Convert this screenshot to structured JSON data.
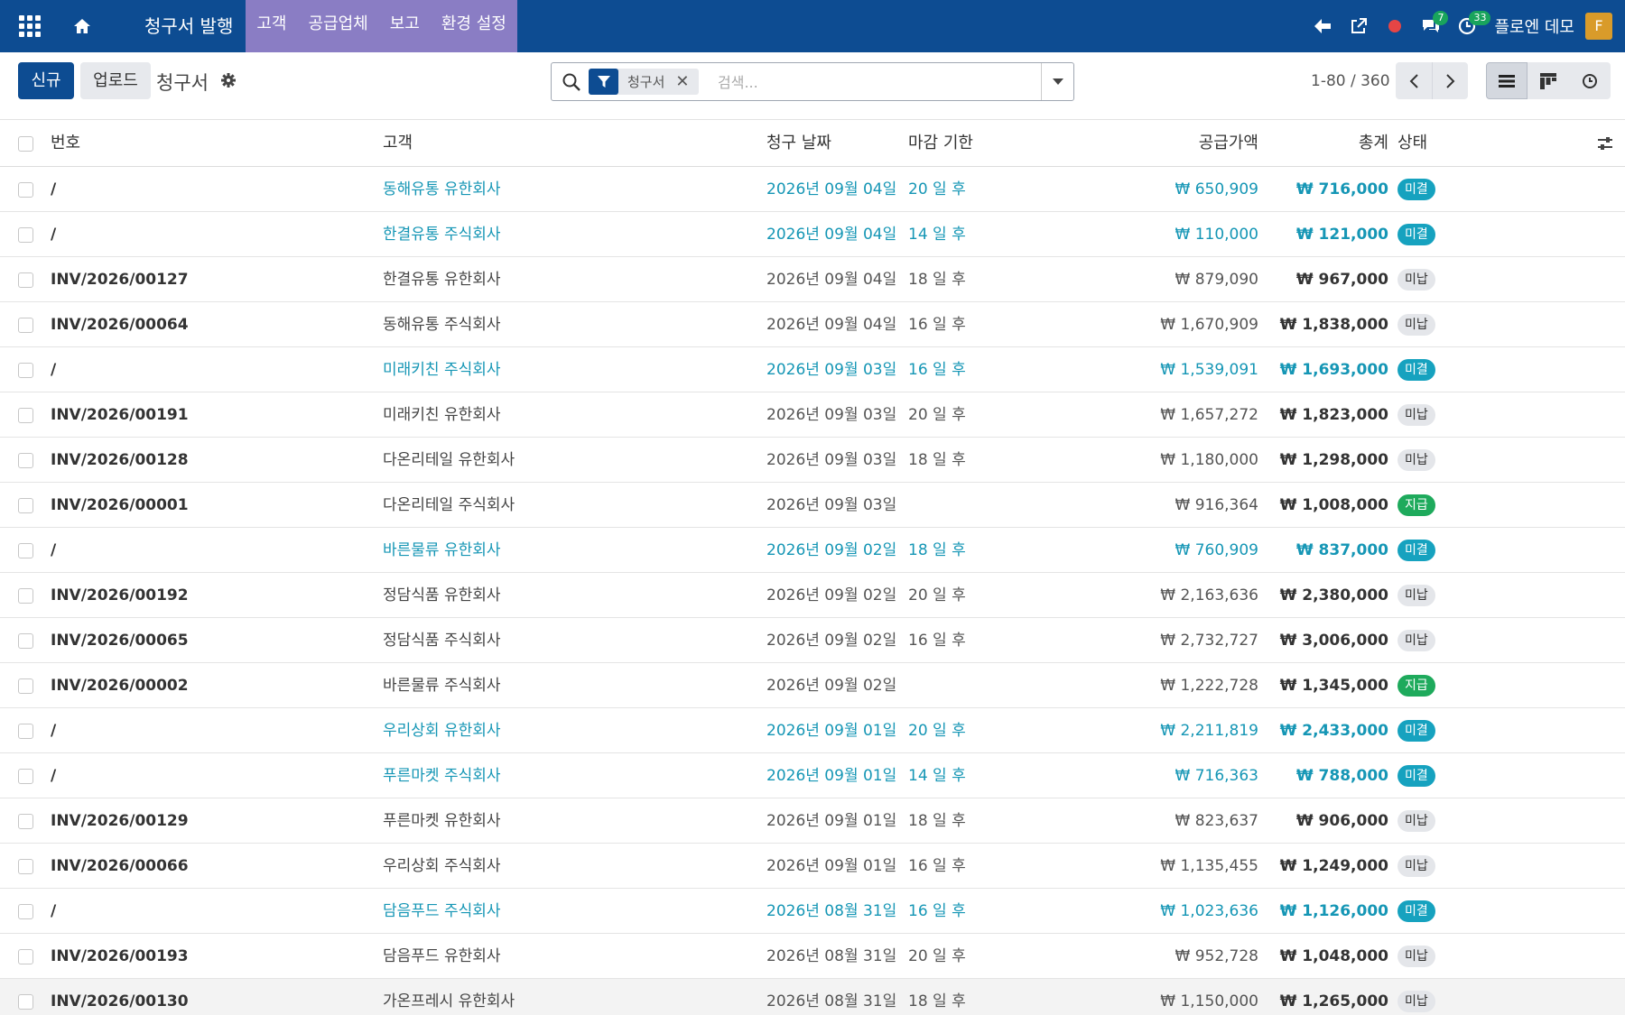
{
  "navbar": {
    "apps_icon": "grid-icon",
    "home_icon": "home-icon",
    "app_title": "청구서 발행",
    "menus": [
      "고객",
      "공급업체",
      "보고",
      "환경 설정"
    ],
    "messages_count": "7",
    "activities_count": "33",
    "company": "플로엔 데모",
    "avatar_letter": "F"
  },
  "control": {
    "new_label": "신규",
    "upload_label": "업로드",
    "breadcrumb": "청구서",
    "search": {
      "facet_label": "청구서",
      "placeholder": "검색..."
    },
    "pager": "1-80 / 360"
  },
  "table": {
    "headers": {
      "number": "번호",
      "customer": "고객",
      "invoice_date": "청구 날짜",
      "due": "마감 기한",
      "untaxed": "공급가액",
      "total": "총계",
      "state": "상태"
    },
    "rows": [
      {
        "number": "/",
        "customer": "동해유통 유한회사",
        "date": "2026년 09월 04일",
        "due": "20 일 후",
        "untaxed": "₩ 650,909",
        "total": "₩ 716,000",
        "state": "미결",
        "kind": "draft"
      },
      {
        "number": "/",
        "customer": "한결유통 주식회사",
        "date": "2026년 09월 04일",
        "due": "14 일 후",
        "untaxed": "₩ 110,000",
        "total": "₩ 121,000",
        "state": "미결",
        "kind": "draft"
      },
      {
        "number": "INV/2026/00127",
        "customer": "한결유통 유한회사",
        "date": "2026년 09월 04일",
        "due": "18 일 후",
        "untaxed": "₩ 879,090",
        "total": "₩ 967,000",
        "state": "미납",
        "kind": "unpaid"
      },
      {
        "number": "INV/2026/00064",
        "customer": "동해유통 주식회사",
        "date": "2026년 09월 04일",
        "due": "16 일 후",
        "untaxed": "₩ 1,670,909",
        "total": "₩ 1,838,000",
        "state": "미납",
        "kind": "unpaid"
      },
      {
        "number": "/",
        "customer": "미래키친 주식회사",
        "date": "2026년 09월 03일",
        "due": "16 일 후",
        "untaxed": "₩ 1,539,091",
        "total": "₩ 1,693,000",
        "state": "미결",
        "kind": "draft"
      },
      {
        "number": "INV/2026/00191",
        "customer": "미래키친 유한회사",
        "date": "2026년 09월 03일",
        "due": "20 일 후",
        "untaxed": "₩ 1,657,272",
        "total": "₩ 1,823,000",
        "state": "미납",
        "kind": "unpaid"
      },
      {
        "number": "INV/2026/00128",
        "customer": "다온리테일 유한회사",
        "date": "2026년 09월 03일",
        "due": "18 일 후",
        "untaxed": "₩ 1,180,000",
        "total": "₩ 1,298,000",
        "state": "미납",
        "kind": "unpaid"
      },
      {
        "number": "INV/2026/00001",
        "customer": "다온리테일 주식회사",
        "date": "2026년 09월 03일",
        "due": "",
        "untaxed": "₩ 916,364",
        "total": "₩ 1,008,000",
        "state": "지급",
        "kind": "paid"
      },
      {
        "number": "/",
        "customer": "바른물류 유한회사",
        "date": "2026년 09월 02일",
        "due": "18 일 후",
        "untaxed": "₩ 760,909",
        "total": "₩ 837,000",
        "state": "미결",
        "kind": "draft"
      },
      {
        "number": "INV/2026/00192",
        "customer": "정담식품 유한회사",
        "date": "2026년 09월 02일",
        "due": "20 일 후",
        "untaxed": "₩ 2,163,636",
        "total": "₩ 2,380,000",
        "state": "미납",
        "kind": "unpaid"
      },
      {
        "number": "INV/2026/00065",
        "customer": "정담식품 주식회사",
        "date": "2026년 09월 02일",
        "due": "16 일 후",
        "untaxed": "₩ 2,732,727",
        "total": "₩ 3,006,000",
        "state": "미납",
        "kind": "unpaid"
      },
      {
        "number": "INV/2026/00002",
        "customer": "바른물류 주식회사",
        "date": "2026년 09월 02일",
        "due": "",
        "untaxed": "₩ 1,222,728",
        "total": "₩ 1,345,000",
        "state": "지급",
        "kind": "paid"
      },
      {
        "number": "/",
        "customer": "우리상회 유한회사",
        "date": "2026년 09월 01일",
        "due": "20 일 후",
        "untaxed": "₩ 2,211,819",
        "total": "₩ 2,433,000",
        "state": "미결",
        "kind": "draft"
      },
      {
        "number": "/",
        "customer": "푸른마켓 주식회사",
        "date": "2026년 09월 01일",
        "due": "14 일 후",
        "untaxed": "₩ 716,363",
        "total": "₩ 788,000",
        "state": "미결",
        "kind": "draft"
      },
      {
        "number": "INV/2026/00129",
        "customer": "푸른마켓 유한회사",
        "date": "2026년 09월 01일",
        "due": "18 일 후",
        "untaxed": "₩ 823,637",
        "total": "₩ 906,000",
        "state": "미납",
        "kind": "unpaid"
      },
      {
        "number": "INV/2026/00066",
        "customer": "우리상회 주식회사",
        "date": "2026년 09월 01일",
        "due": "16 일 후",
        "untaxed": "₩ 1,135,455",
        "total": "₩ 1,249,000",
        "state": "미납",
        "kind": "unpaid"
      },
      {
        "number": "/",
        "customer": "담음푸드 주식회사",
        "date": "2026년 08월 31일",
        "due": "16 일 후",
        "untaxed": "₩ 1,023,636",
        "total": "₩ 1,126,000",
        "state": "미결",
        "kind": "draft"
      },
      {
        "number": "INV/2026/00193",
        "customer": "담음푸드 유한회사",
        "date": "2026년 08월 31일",
        "due": "20 일 후",
        "untaxed": "₩ 952,728",
        "total": "₩ 1,048,000",
        "state": "미납",
        "kind": "unpaid"
      },
      {
        "number": "INV/2026/00130",
        "customer": "가온프레시 유한회사",
        "date": "2026년 08월 31일",
        "due": "18 일 후",
        "untaxed": "₩ 1,150,000",
        "total": "₩ 1,265,000",
        "state": "미납",
        "kind": "unpaid",
        "hover": true
      }
    ]
  },
  "colors": {
    "navbar": "#0d4c92",
    "menu_highlight": "#7567b5",
    "draft_text": "#1596b5",
    "badge_draft": "#16a2bf",
    "badge_paid": "#1eaa5c",
    "badge_unpaid": "#e4e6ea"
  }
}
